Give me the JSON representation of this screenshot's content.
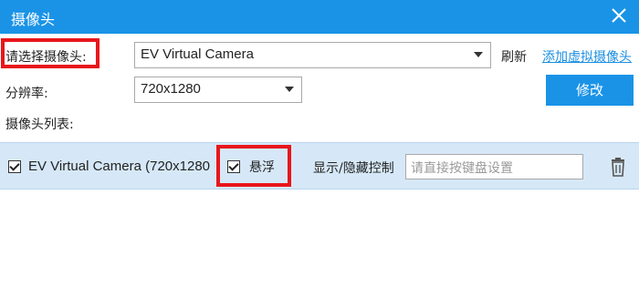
{
  "window": {
    "title": "摄像头"
  },
  "form": {
    "select_camera_label": "请选择摄像头:",
    "camera_select_value": "EV Virtual Camera",
    "refresh_label": "刷新",
    "add_virtual_camera_link": "添加虚拟摄像头",
    "resolution_label": "分辨率:",
    "resolution_select_value": "720x1280",
    "edit_button": "修改",
    "camera_list_label": "摄像头列表:"
  },
  "camera_list": [
    {
      "name": "EV Virtual Camera (720x1280",
      "checked": true,
      "float_label": "悬浮",
      "float_checked": true,
      "toggle_label": "显示/隐藏控制",
      "hotkey_placeholder": "请直接按键盘设置"
    }
  ],
  "colors": {
    "accent": "#1a93e7",
    "highlight_box": "#e8161b",
    "row_background": "#d6e8f7",
    "link": "#1a8ee1"
  },
  "icons": {
    "close": "close-icon",
    "trash": "trash-icon",
    "dropdown": "chevron-down-icon",
    "checkbox": "checkmark-icon"
  }
}
